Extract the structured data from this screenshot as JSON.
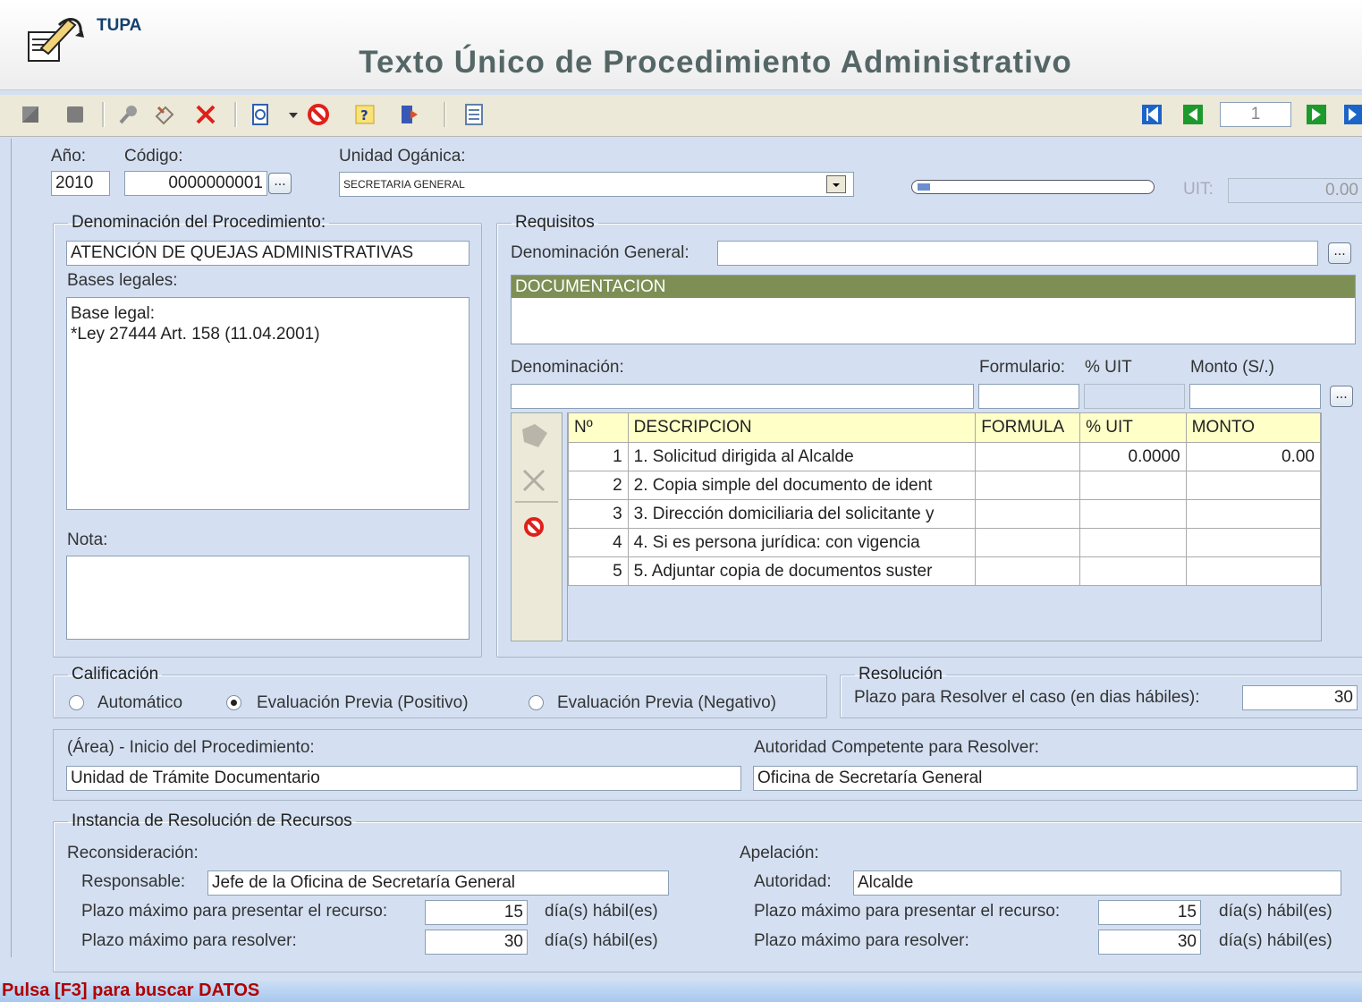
{
  "header": {
    "app_name": "TUPA",
    "title": "Texto Único de Procedimiento Administrativo"
  },
  "toolbar": {
    "page_number": "1"
  },
  "form": {
    "anio_label": "Año:",
    "anio_value": "2010",
    "codigo_label": "Código:",
    "codigo_value": "0000000001",
    "unidad_label": "Unidad Ogánica:",
    "unidad_value": "SECRETARIA GENERAL",
    "uit_label": "UIT:",
    "uit_value": "0.00"
  },
  "procedimiento": {
    "legend": "Denominación del Procedimiento:",
    "name": "ATENCIÓN DE QUEJAS ADMINISTRATIVAS",
    "bases_label": "Bases legales:",
    "bases_line1": "Base legal:",
    "bases_line2": "*Ley 27444 Art. 158 (11.04.2001)",
    "nota_label": "Nota:"
  },
  "requisitos": {
    "legend": "Requisitos",
    "den_general_label": "Denominación General:",
    "selected_item": "DOCUMENTACION",
    "denominacion_label": "Denominación:",
    "formulario_label": "Formulario:",
    "uit_label": "% UIT",
    "monto_label": "Monto (S/.)",
    "columns": [
      "Nº",
      "DESCRIPCION",
      "FORMULA",
      "% UIT",
      "MONTO"
    ],
    "rows": [
      {
        "n": "1",
        "desc": "1. Solicitud dirigida al Alcalde",
        "formula": "",
        "uit": "0.0000",
        "monto": "0.00"
      },
      {
        "n": "2",
        "desc": "2. Copia simple del documento de ident",
        "formula": "",
        "uit": "",
        "monto": ""
      },
      {
        "n": "3",
        "desc": "3. Dirección domiciliaria del solicitante y",
        "formula": "",
        "uit": "",
        "monto": ""
      },
      {
        "n": "4",
        "desc": "4. Si es persona jurídica:  con vigencia",
        "formula": "",
        "uit": "",
        "monto": ""
      },
      {
        "n": "5",
        "desc": "5. Adjuntar copia de documentos suster",
        "formula": "",
        "uit": "",
        "monto": ""
      }
    ]
  },
  "calificacion": {
    "legend": "Calificación",
    "opt1": "Automático",
    "opt2": "Evaluación Previa (Positivo)",
    "opt3": "Evaluación Previa (Negativo)",
    "selected": "Evaluación Previa (Positivo)"
  },
  "resolucion": {
    "legend": "Resolución",
    "plazo_label": "Plazo para Resolver el caso (en dias hábiles):",
    "plazo_value": "30"
  },
  "area": {
    "inicio_label": "(Área) - Inicio del Procedimiento:",
    "inicio_value": "Unidad de Trámite Documentario",
    "autoridad_label": "Autoridad Competente para Resolver:",
    "autoridad_value": "Oficina de Secretaría General"
  },
  "instancia": {
    "legend": "Instancia de Resolución de Recursos",
    "recon_label": "Reconsideración:",
    "responsable_label": "Responsable:",
    "responsable_value": "Jefe de la Oficina de Secretaría General",
    "plazo_presentar_label": "Plazo máximo para presentar el recurso:",
    "recon_presentar": "15",
    "plazo_resolver_label": "Plazo máximo para resolver:",
    "recon_resolver": "30",
    "dias_label": "día(s) hábil(es)",
    "apel_label": "Apelación:",
    "autoridad_label": "Autoridad:",
    "autoridad_value": "Alcalde",
    "apel_presentar": "15",
    "apel_resolver": "30"
  },
  "status": {
    "message": "Pulsa [F3] para buscar DATOS"
  }
}
